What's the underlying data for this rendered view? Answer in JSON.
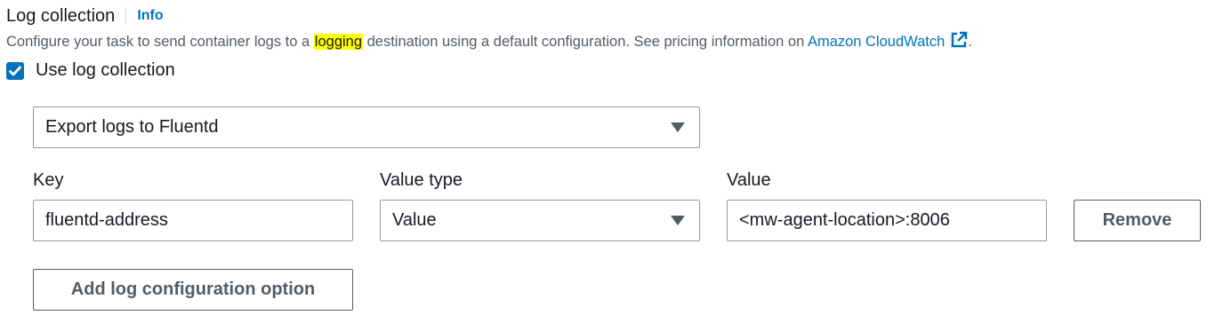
{
  "header": {
    "title": "Log collection",
    "info_label": "Info"
  },
  "description": {
    "before": "Configure your task to send container logs to a ",
    "highlight": "logging",
    "after": " destination using a default configuration. See pricing information on ",
    "link": "Amazon CloudWatch",
    "end": "."
  },
  "use_log_collection": {
    "label": "Use log collection",
    "checked": true
  },
  "export_select": {
    "value": "Export logs to Fluentd"
  },
  "fields": {
    "key_label": "Key",
    "value_type_label": "Value type",
    "value_label": "Value"
  },
  "row": {
    "key": "fluentd-address",
    "value_type": "Value",
    "value": "<mw-agent-location>:8006",
    "remove_label": "Remove"
  },
  "add_button_label": "Add log configuration option",
  "icons": {
    "info": "info-link",
    "external": "external-link-icon",
    "check": "check-icon",
    "dropdown": "caret-down-icon"
  },
  "colors": {
    "accent": "#0073bb",
    "highlight": "#ffff00",
    "muted_text": "#545b64"
  }
}
